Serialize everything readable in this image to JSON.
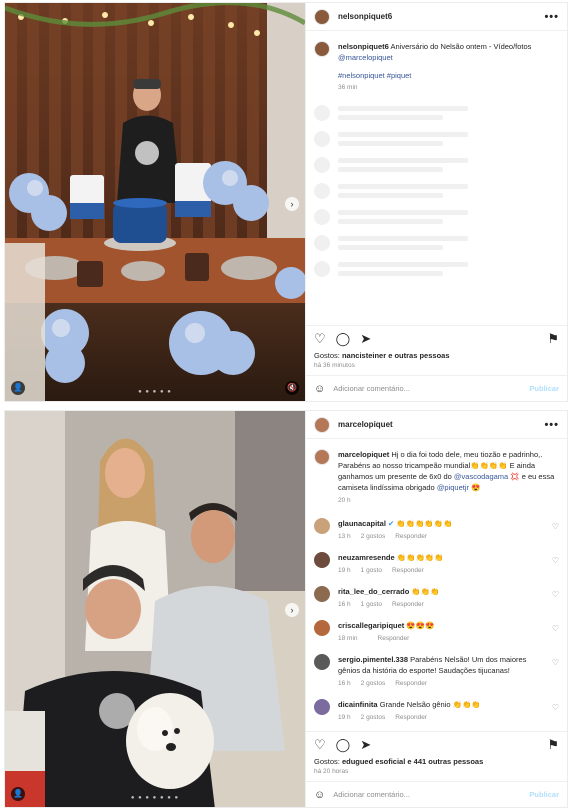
{
  "post1": {
    "username": "nelsonpiquet6",
    "caption_user": "nelsonpiquet6",
    "caption_text": "Aniversário do Nelsão ontem - Vídeo/fotos",
    "caption_mention": "@marcelopiquet",
    "hashtags": "#nelsonpiquet #piquet",
    "caption_time": "36 min",
    "likes_prefix": "Gostos:",
    "likes_user": "nancisteiner",
    "likes_suffix": "e outras pessoas",
    "time": "há 36 minutos",
    "comment_placeholder": "Adicionar comentário...",
    "publish": "Publicar"
  },
  "post2": {
    "username": "marcelopiquet",
    "caption_user": "marcelopiquet",
    "caption_text_1": "Hj o dia foi todo dele, meu tiozão e padrinho,. Parabéns ao nosso tricampeão mundial👏👏👏👏 E ainda ganhamos um presente de 6x0 do",
    "caption_mention_1": "@vascodagama",
    "caption_text_2": "💢 e eu essa camiseta lindíssima obrigado",
    "caption_mention_2": "@piquetjr",
    "caption_text_3": "😍",
    "caption_time": "20 h",
    "comments": [
      {
        "user": "glaunacapital",
        "badge": "✔",
        "text": "👏👏👏👏👏👏",
        "time": "13 h",
        "likes": "2 gostos",
        "reply": "Responder",
        "color": "#c9a27a"
      },
      {
        "user": "neuzamresende",
        "badge": "",
        "text": "👏👏👏👏👏",
        "time": "19 h",
        "likes": "1 gosto",
        "reply": "Responder",
        "color": "#6d4c3d"
      },
      {
        "user": "rita_lee_do_cerrado",
        "badge": "",
        "text": "👏👏👏",
        "time": "16 h",
        "likes": "1 gosto",
        "reply": "Responder",
        "color": "#8b6a4f"
      },
      {
        "user": "criscallegaripiquet",
        "badge": "",
        "text": "😍😍😍",
        "time": "18 min",
        "likes": "",
        "reply": "Responder",
        "color": "#b5683c"
      },
      {
        "user": "sergio.pimentel.338",
        "badge": "",
        "text": "Parabéns Nelsão! Um dos maiores gênios da história do esporte! Saudações tijucanas!",
        "time": "16 h",
        "likes": "2 gostos",
        "reply": "Responder",
        "color": "#5a5a5a"
      },
      {
        "user": "dicainfinita",
        "badge": "",
        "text": "Grande Nelsão gênio 👏👏👏",
        "time": "19 h",
        "likes": "2 gostos",
        "reply": "Responder",
        "color": "#7b6b9e"
      }
    ],
    "likes_prefix": "Gostos:",
    "likes_user": "edugued esoficial",
    "likes_suffix": "e 441 outras pessoas",
    "time": "há 20 horas",
    "comment_placeholder": "Adicionar comentário...",
    "publish": "Publicar"
  },
  "icons": {
    "more": "•••",
    "heart": "♡",
    "comment": "◯",
    "share": "➤",
    "save": "⚑",
    "emoji": "☺",
    "arrow": "›",
    "user": "👤",
    "mute": "🔇"
  }
}
